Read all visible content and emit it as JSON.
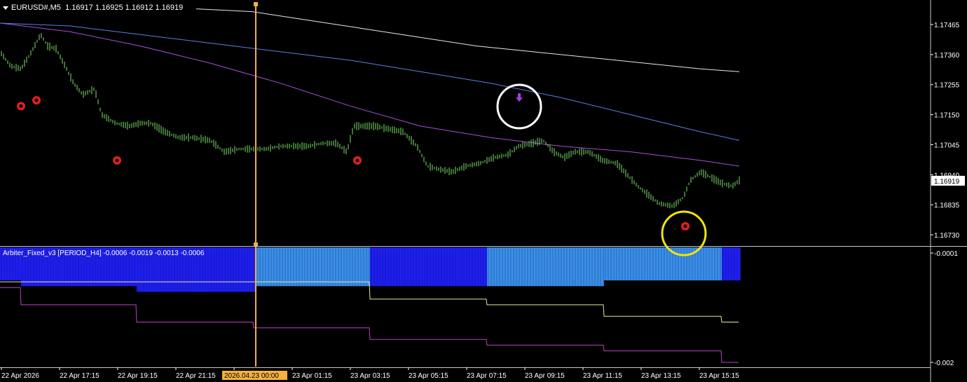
{
  "header": {
    "symbol": "EURUSD#,M5",
    "ohlc": "1.16917 1.16925 1.16912 1.16919"
  },
  "indicator": {
    "label": "Arbiter_Fixed_v3 [PERIOD_H4] -0.0006 -0.0019 -0.0013 -0.0006"
  },
  "colors": {
    "background": "#000000",
    "price": "#7ee36b",
    "ma_white": "#e8e8e8",
    "ma_blue": "#5a7ee8",
    "ma_purple": "#a64fd8",
    "marker_red": "#e02020",
    "circle_white": "#ffffff",
    "circle_yellow": "#f2e600",
    "arrow_purple": "#a040e0",
    "vline": "#f5b040",
    "hist_dark": "#1e1eef",
    "hist_light": "#3a8fe8",
    "ind_yellow": "#e8e89a",
    "ind_magenta": "#c040c0",
    "axis_text": "#ffffff",
    "grid_line": "#c8c8c8"
  },
  "chart_data": [
    {
      "type": "line",
      "title": "EURUSD#,M5",
      "y_ticks": [
        "1.17465",
        "1.17360",
        "1.17255",
        "1.17150",
        "1.17045",
        "1.16940",
        "1.16835",
        "1.16730"
      ],
      "current_price_label": "1.16919",
      "ylim": [
        1.1669,
        1.1752
      ],
      "x_labels": [
        "22 Apr 2026",
        "22 Apr 17:15",
        "22 Apr 19:15",
        "22 Apr 21:15",
        "2026.04.23 00:00",
        "23 Apr 01:15",
        "23 Apr 03:15",
        "23 Apr 05:15",
        "23 Apr 07:15",
        "23 Apr 09:15",
        "23 Apr 11:15",
        "23 Apr 13:15",
        "23 Apr 15:15"
      ],
      "highlighted_x_label": "2026.04.23 00:00",
      "series": [
        {
          "label": "price",
          "x": [
            0,
            15,
            30,
            45,
            58,
            68,
            80,
            95,
            105,
            118,
            135,
            145,
            165,
            185,
            200,
            215,
            235,
            255,
            275,
            300,
            320,
            340,
            362,
            380,
            400,
            420,
            440,
            460,
            480,
            495,
            505,
            515,
            535,
            555,
            575,
            595,
            610,
            625,
            645,
            665,
            685,
            705,
            725,
            740,
            760,
            775,
            790,
            805,
            820,
            840,
            860,
            880,
            895,
            910,
            925,
            940,
            960,
            975,
            985,
            1000,
            1015,
            1030,
            1045,
            1055
          ],
          "y": [
            1.1737,
            1.1732,
            1.1731,
            1.1737,
            1.1743,
            1.1739,
            1.1738,
            1.1731,
            1.1726,
            1.1722,
            1.1724,
            1.1715,
            1.1712,
            1.1711,
            1.1712,
            1.1712,
            1.1709,
            1.1707,
            1.1707,
            1.1706,
            1.1702,
            1.1703,
            1.1703,
            1.1703,
            1.1704,
            1.1704,
            1.1704,
            1.1705,
            1.1705,
            1.1702,
            1.1711,
            1.1711,
            1.1711,
            1.171,
            1.1709,
            1.1704,
            1.1697,
            1.1696,
            1.1695,
            1.1697,
            1.1698,
            1.17,
            1.1701,
            1.1704,
            1.1705,
            1.1706,
            1.1702,
            1.17,
            1.1702,
            1.1702,
            1.1699,
            1.1698,
            1.1694,
            1.169,
            1.1687,
            1.1684,
            1.1683,
            1.1686,
            1.1692,
            1.1695,
            1.1693,
            1.1691,
            1.169,
            1.1692
          ]
        },
        {
          "label": "ma_white",
          "x": [
            280,
            360,
            440,
            520,
            600,
            680,
            760,
            840,
            920,
            1000,
            1055
          ],
          "y": [
            1.1752,
            1.1751,
            1.1748,
            1.1745,
            1.1742,
            1.1739,
            1.1737,
            1.1735,
            1.1733,
            1.1731,
            1.173
          ]
        },
        {
          "label": "ma_blue",
          "x": [
            0,
            100,
            200,
            300,
            400,
            500,
            600,
            700,
            800,
            900,
            1000,
            1055
          ],
          "y": [
            1.1747,
            1.1746,
            1.1743,
            1.174,
            1.1737,
            1.1734,
            1.173,
            1.1726,
            1.1721,
            1.1715,
            1.1709,
            1.1706
          ]
        },
        {
          "label": "ma_purple",
          "x": [
            0,
            100,
            200,
            300,
            400,
            500,
            600,
            700,
            800,
            900,
            1000,
            1055
          ],
          "y": [
            1.1747,
            1.1744,
            1.1739,
            1.1733,
            1.1726,
            1.1718,
            1.1711,
            1.1707,
            1.1704,
            1.1702,
            1.1699,
            1.1697
          ]
        }
      ],
      "markers": [
        {
          "kind": "star",
          "x": 30,
          "y": 1.1718
        },
        {
          "kind": "star",
          "x": 52,
          "y": 1.172
        },
        {
          "kind": "star",
          "x": 167,
          "y": 1.1699
        },
        {
          "kind": "star",
          "x": 510,
          "y": 1.1699
        },
        {
          "kind": "star",
          "x": 978,
          "y": 1.1676
        },
        {
          "kind": "arrow-down",
          "x": 741,
          "y": 1.1721
        }
      ]
    },
    {
      "type": "bar",
      "title": "Arbiter_Fixed_v3 [PERIOD_H4]",
      "y_ticks": [
        "-0.0001",
        "-0.002"
      ],
      "ylim": [
        -0.0021,
        -0.0001
      ],
      "histogram_segments": [
        {
          "x0": 0,
          "x1": 30,
          "value": -0.0006,
          "color": "dark"
        },
        {
          "x0": 30,
          "x1": 195,
          "value": -0.0007,
          "color": "dark"
        },
        {
          "x0": 195,
          "x1": 365,
          "value": -0.0008,
          "color": "dark"
        },
        {
          "x0": 365,
          "x1": 528,
          "value": -0.0007,
          "color": "light"
        },
        {
          "x0": 528,
          "x1": 695,
          "value": -0.0007,
          "color": "dark"
        },
        {
          "x0": 695,
          "x1": 862,
          "value": -0.0007,
          "color": "light"
        },
        {
          "x0": 862,
          "x1": 1030,
          "value": -0.0006,
          "color": "light"
        },
        {
          "x0": 1030,
          "x1": 1057,
          "value": -0.0006,
          "color": "dark"
        }
      ],
      "series": [
        {
          "label": "yellow",
          "steps": [
            [
              0,
              30,
              -0.0006
            ],
            [
              30,
              195,
              -0.0006
            ],
            [
              195,
              362,
              -0.0006
            ],
            [
              362,
              528,
              -0.0006
            ],
            [
              528,
              695,
              -0.0009
            ],
            [
              695,
              862,
              -0.001
            ],
            [
              862,
              1030,
              -0.0012
            ],
            [
              1030,
              1055,
              -0.0013
            ]
          ]
        },
        {
          "label": "magenta",
          "steps": [
            [
              0,
              30,
              -0.0007
            ],
            [
              30,
              195,
              -0.001
            ],
            [
              195,
              362,
              -0.0013
            ],
            [
              362,
              528,
              -0.0014
            ],
            [
              528,
              695,
              -0.0016
            ],
            [
              695,
              862,
              -0.0017
            ],
            [
              862,
              1030,
              -0.0018
            ],
            [
              1030,
              1055,
              -0.002
            ]
          ]
        }
      ]
    }
  ]
}
